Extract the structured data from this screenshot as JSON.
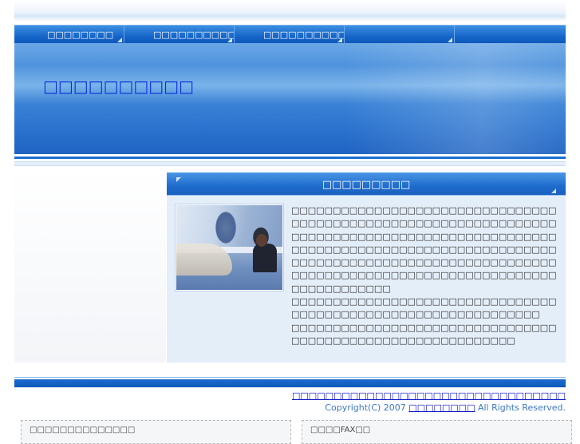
{
  "nav": {
    "items": [
      {
        "label": "□□□□□□□□"
      },
      {
        "label": "□□□□□□□□□□□"
      },
      {
        "label": "□□□□□□□□□□□"
      },
      {
        "label": ""
      },
      {
        "label": ""
      }
    ]
  },
  "banner": {
    "title": "□□□□□□□□□□"
  },
  "content": {
    "header": "□□□□□□□□□",
    "paragraphs": [
      "□□□□□□□□□□□□□□□□□□□□□□□□□□□□□□□□□□□□□□□□□□□□□□□□□□□□□□□□□□□□□□□□□□□□□□□□□□□□□□□□□□□□□□□□□□□□□□□□□□□□□□□□□□□□□□□□□□□□□□□□□□□□□□□□□□□□□□□□□□□□□□□□□□□□□□□□□□□□□□□□□□□□□□□□□□□□□□□□□□□□□□□□□□□□□□□□□□□□□□□□□□□□",
      "□□□□□□□□□□□□□□□□□□□□□□□□□□□□□□□□□□□□□□□□□□□□□□□□□□□□□□□□□□□□□□",
      "□□□□□□□□□□□□□□□□□□□□□□□□□□□□□□□□□□□□□□□□□□□□□□□□□□□□□□□□□□□"
    ]
  },
  "footer": {
    "links": "□□□□□□□□□□□□□□□□□□□□□□□□□□□□□□□□□",
    "copyright_prefix": "Copyright(C) 2007",
    "company": "□□□□□□□□",
    "copyright_suffix": "All Rights Reserved."
  },
  "boxes": {
    "left": "□□□□□□□□□□□□□□",
    "right": "□□□□FAX□□"
  },
  "colors": {
    "nav_blue": "#1565c9",
    "banner_title": "#0a2fd6",
    "link_blue": "#0a12c9",
    "content_bg": "#e4eef9"
  }
}
